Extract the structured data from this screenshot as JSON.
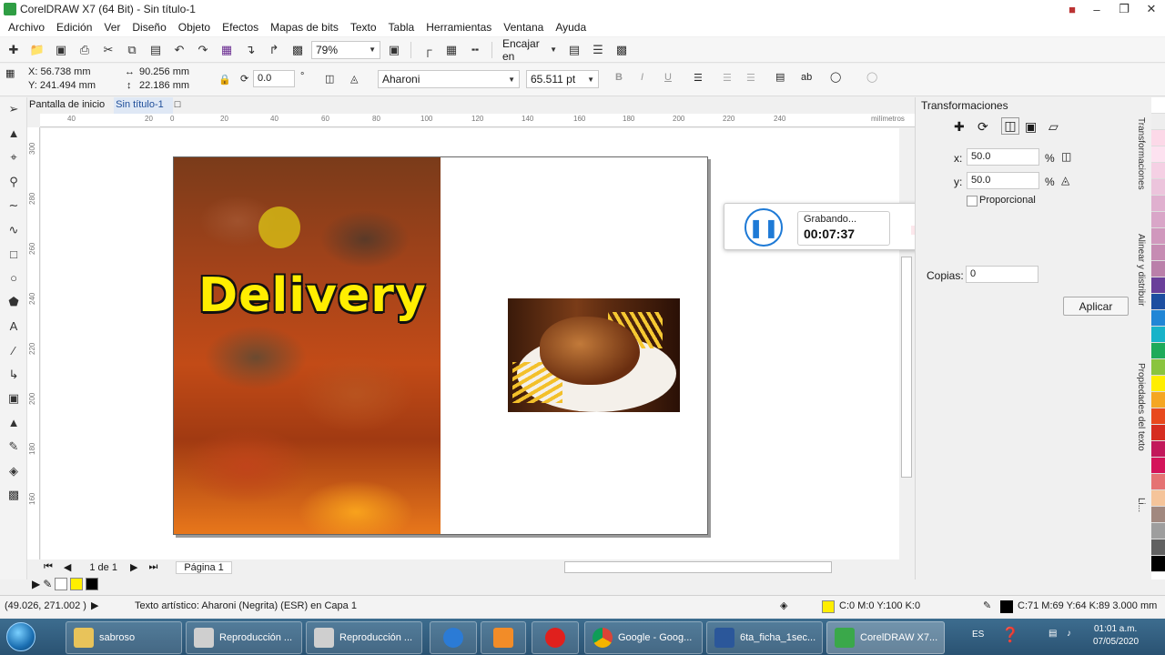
{
  "window": {
    "title": "CorelDRAW X7 (64 Bit) - Sin título-1"
  },
  "menu": [
    "Archivo",
    "Edición",
    "Ver",
    "Diseño",
    "Objeto",
    "Efectos",
    "Mapas de bits",
    "Texto",
    "Tabla",
    "Herramientas",
    "Ventana",
    "Ayuda"
  ],
  "toolbar": {
    "zoom": "79%",
    "snap_label": "Encajar en"
  },
  "properties": {
    "x": "X: 56.738 mm",
    "y": "Y: 241.494 mm",
    "width": "90.256 mm",
    "height": "22.186 mm",
    "rotation": "0.0",
    "degree_symbol": "°",
    "font": "Aharoni",
    "font_size": "65.511 pt"
  },
  "doc_tabs": {
    "home": "Pantalla de inicio",
    "active": "Sin título-1"
  },
  "ruler": {
    "unit": "milímetros",
    "h_ticks": [
      "40",
      "20",
      "0",
      "20",
      "40",
      "60",
      "80",
      "100",
      "120",
      "140",
      "160",
      "180",
      "200",
      "220",
      "240"
    ],
    "v_ticks": [
      "300",
      "280",
      "260",
      "240",
      "220",
      "200",
      "180",
      "160"
    ]
  },
  "canvas": {
    "headline": "Delivery"
  },
  "recorder": {
    "label": "Grabando...",
    "time": "00:07:37"
  },
  "page_nav": {
    "count": "1 de 1",
    "tab": "Página 1"
  },
  "status": {
    "coords": "(49.026, 271.002 )",
    "object": "Texto artístico: Aharoni (Negrita) (ESR) en Capa 1",
    "fill": "C:0 M:0 Y:100 K:0",
    "outline": "C:71 M:69 Y:64 K:89  3.000 mm"
  },
  "docker": {
    "title": "Transformaciones",
    "x_label": "x:",
    "x_value": "50.0",
    "y_label": "y:",
    "y_value": "50.0",
    "percent": "%",
    "proportional": "Proporcional",
    "copies_label": "Copias:",
    "copies_value": "0",
    "apply": "Aplicar",
    "vtabs": [
      "Transformaciones",
      "Alinear y distribuir",
      "Propiedades del texto",
      "Li..."
    ]
  },
  "colors": {
    "fill": "#ffee00",
    "outline": "#111111",
    "accent": "#1e7ad6"
  },
  "taskbar": {
    "items": [
      "sabroso",
      "Reproducción ...",
      "Reproducción ...",
      "Google - Goog...",
      "6ta_ficha_1sec...",
      "CorelDRAW X7..."
    ],
    "lang": "ES",
    "time": "01:01 a.m.",
    "date": "07/05/2020"
  }
}
